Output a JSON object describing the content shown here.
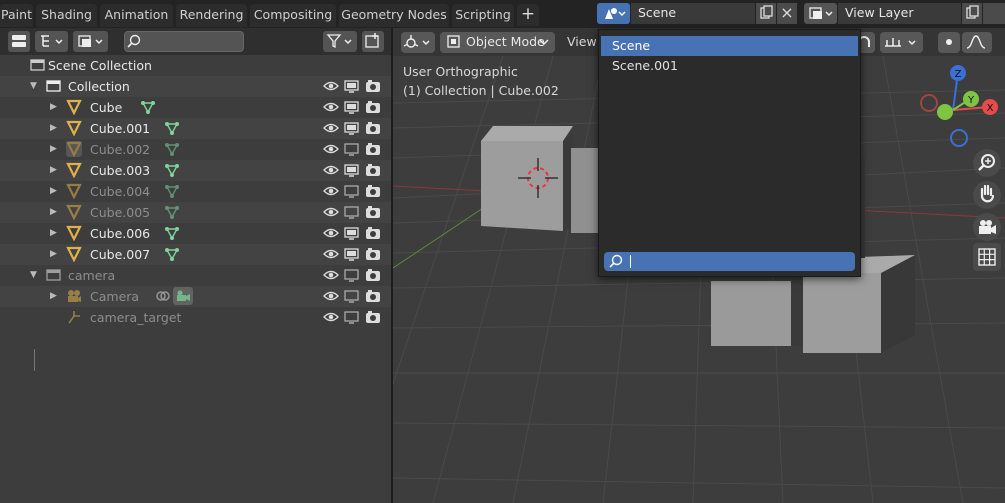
{
  "workspace_tabs": [
    {
      "label": "Paint"
    },
    {
      "label": "Shading"
    },
    {
      "label": "Animation"
    },
    {
      "label": "Rendering"
    },
    {
      "label": "Compositing"
    },
    {
      "label": "Geometry Nodes"
    },
    {
      "label": "Scripting"
    }
  ],
  "add_workspace": "+",
  "scene_selector": {
    "value": "Scene",
    "close": "×"
  },
  "view_layer_selector": {
    "value": "View Layer"
  },
  "outliner": {
    "rows": [
      {
        "label": "Scene Collection",
        "type": "scene",
        "indent": 0,
        "dim": false,
        "expander": ""
      },
      {
        "label": "Collection",
        "type": "collection",
        "indent": 1,
        "dim": false,
        "expander": "▼"
      },
      {
        "label": "Cube",
        "type": "mesh",
        "indent": 2,
        "dim": false,
        "expander": "▶"
      },
      {
        "label": "Cube.001",
        "type": "mesh",
        "indent": 2,
        "dim": false,
        "expander": "▶"
      },
      {
        "label": "Cube.002",
        "type": "mesh",
        "indent": 2,
        "dim": true,
        "expander": "▶"
      },
      {
        "label": "Cube.003",
        "type": "mesh",
        "indent": 2,
        "dim": false,
        "expander": "▶"
      },
      {
        "label": "Cube.004",
        "type": "mesh",
        "indent": 2,
        "dim": true,
        "expander": "▶"
      },
      {
        "label": "Cube.005",
        "type": "mesh",
        "indent": 2,
        "dim": true,
        "expander": "▶"
      },
      {
        "label": "Cube.006",
        "type": "mesh",
        "indent": 2,
        "dim": false,
        "expander": "▶"
      },
      {
        "label": "Cube.007",
        "type": "mesh",
        "indent": 2,
        "dim": false,
        "expander": "▶"
      },
      {
        "label": "camera",
        "type": "collection",
        "indent": 1,
        "dim": true,
        "expander": "▼"
      },
      {
        "label": "Camera",
        "type": "camera",
        "indent": 2,
        "dim": true,
        "expander": "▶"
      },
      {
        "label": "camera_target",
        "type": "empty",
        "indent": 2,
        "dim": true,
        "expander": ""
      }
    ]
  },
  "viewport": {
    "mode": "Object Mode",
    "view_menu": "View",
    "overlay_title": "User Orthographic",
    "overlay_subtitle": "(1) Collection | Cube.002",
    "gizmo": {
      "z": "Z",
      "y": "Y",
      "x": "X"
    }
  },
  "scene_dropdown": {
    "items": [
      {
        "label": "Scene",
        "selected": true
      },
      {
        "label": "Scene.001",
        "selected": false
      }
    ],
    "search_value": ""
  },
  "colors": {
    "accent": "#4772b3",
    "mesh_icon": "#e0b04a",
    "modifier_icon": "#7fd59b",
    "x_axis": "#e54b4b",
    "y_axis": "#7ec544",
    "z_axis": "#3b6fd8"
  }
}
